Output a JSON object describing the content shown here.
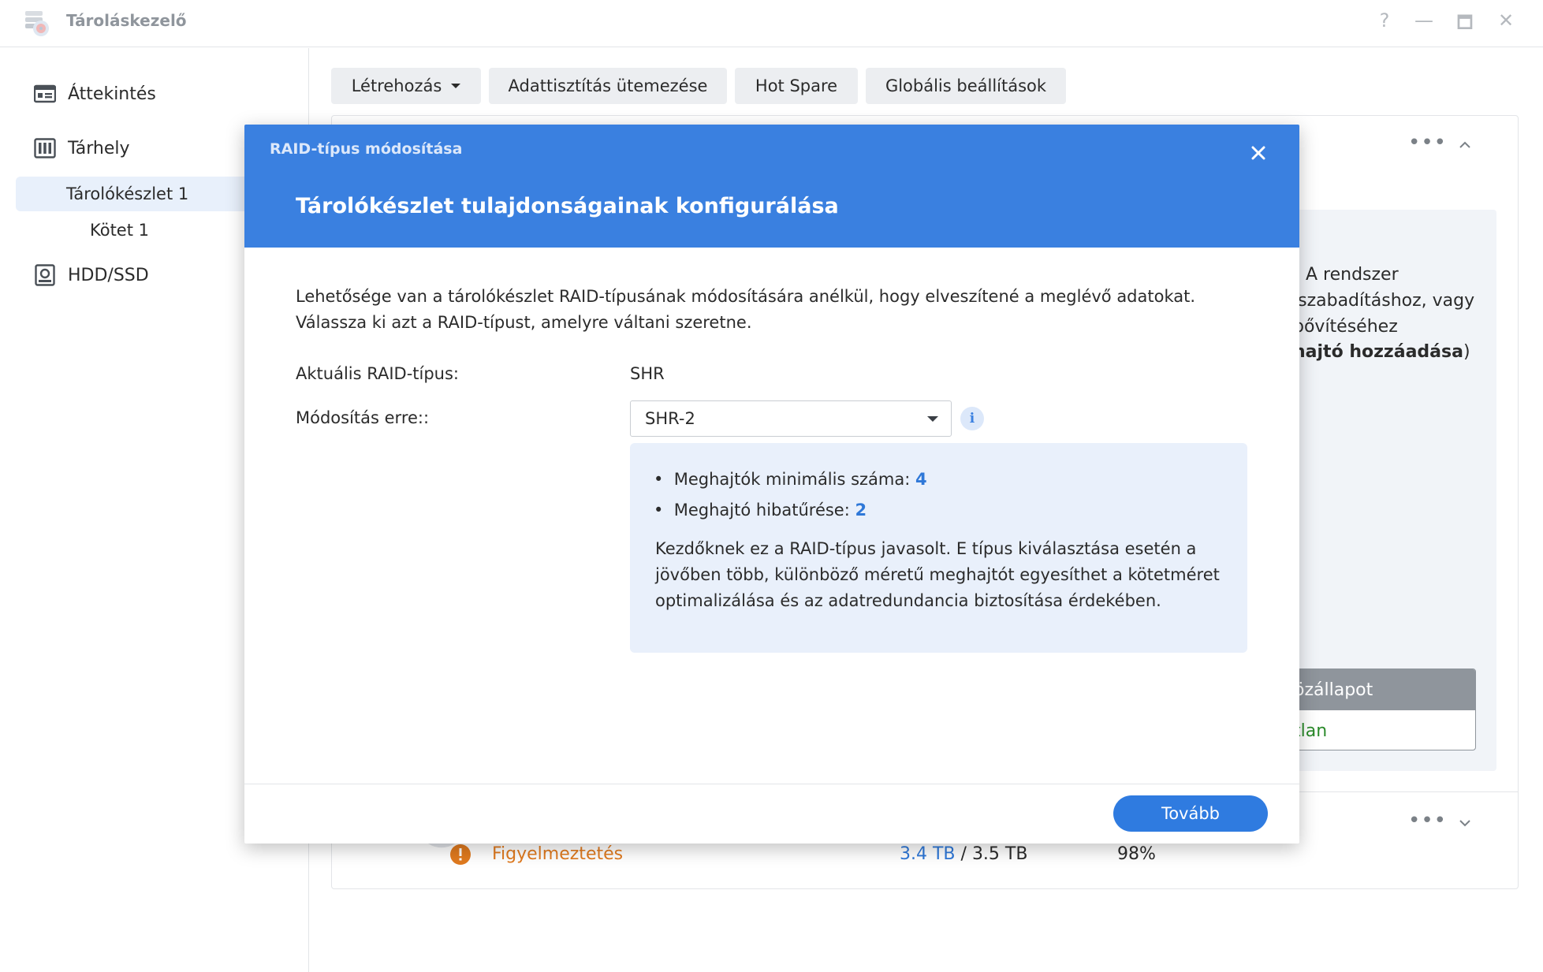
{
  "window": {
    "title": "Tároláskezelő",
    "controls": [
      "?",
      "—",
      "🗖",
      "✕"
    ]
  },
  "sidebar": {
    "items": [
      {
        "label": "Áttekintés",
        "icon": "overview-icon"
      },
      {
        "label": "Tárhely",
        "icon": "storage-icon"
      },
      {
        "label": "Tárolókészlet 1"
      },
      {
        "label": "Kötet 1"
      },
      {
        "label": "HDD/SSD",
        "icon": "hdd-icon"
      }
    ],
    "selected": "Tárolókészlet 1"
  },
  "toolbar": {
    "create": "Létrehozás",
    "scrub": "Adattisztítás ütemezése",
    "hotspare": "Hot Spare",
    "global": "Globális beállítások"
  },
  "background": {
    "line1": "A rendszer",
    "line2": "lszabadításhoz, vagy",
    "line3": "bővítéséhez",
    "line4_bold": "hajtó hozzáadása",
    "line4_end": ")",
    "table_head": "özállapot",
    "table_cell": "tlan",
    "warning": "Figyelmeztetés",
    "used": "3.4 TB",
    "sep": "/",
    "total": "3.5 TB",
    "percent": "98%"
  },
  "modal": {
    "title": "RAID-típus módosítása",
    "heading": "Tárolókészlet tulajdonságainak konfigurálása",
    "intro1": "Lehetősége van a tárolókészlet RAID-típusának módosítására anélkül, hogy elveszítené a meglévő adatokat.",
    "intro2": "Válassza ki azt a RAID-típust, amelyre váltani szeretne.",
    "current_label": "Aktuális RAID-típus:",
    "current_value": "SHR",
    "change_label": "Módosítás erre::",
    "select_value": "SHR-2",
    "bullet1_label": "Meghajtók minimális száma:",
    "bullet1_value": "4",
    "bullet2_label": "Meghajtó hibatűrése:",
    "bullet2_value": "2",
    "description": "Kezdőknek ez a RAID-típus javasolt. E típus kiválasztása esetén a jövőben több, különböző méretű meghajtót egyesíthet a kötetméret optimalizálása és az adatredundancia biztosítása érdekében.",
    "next": "Tovább"
  },
  "colors": {
    "accent": "#3a80e0",
    "warning": "#e07a1f",
    "healthy": "#2a8a2a"
  }
}
